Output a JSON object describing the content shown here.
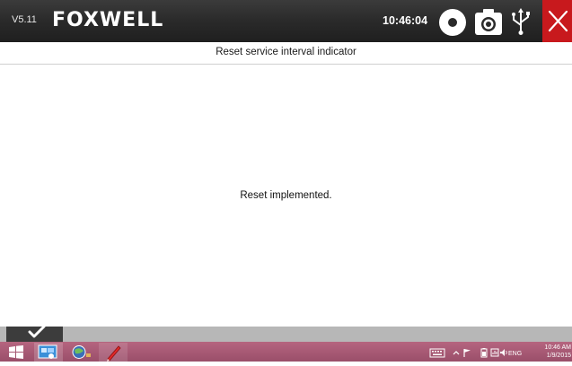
{
  "header": {
    "version": "V5.11",
    "logo_text": "FOXWELL",
    "clock": "10:46:04",
    "icons": [
      "record-icon",
      "camera-icon",
      "usb-icon",
      "close-icon"
    ],
    "close_color": "#c8191d"
  },
  "subtitle": "Reset service interval indicator",
  "main": {
    "message": "Reset implemented."
  },
  "bottom_bar": {
    "ok_icon": "check-icon"
  },
  "taskbar": {
    "start_icon": "windows-start-icon",
    "apps": [
      "desktop-app-icon",
      "globe-app-icon",
      "pen-app-icon"
    ],
    "tray_icons": [
      "keyboard-icon",
      "chevron-up-icon",
      "flag-icon",
      "battery-icon",
      "network-icon",
      "volume-icon"
    ],
    "language": "ENG",
    "time": "10:46 AM",
    "date": "1/9/2015"
  },
  "colors": {
    "header_bg": "#2a2a2a",
    "taskbar_bg": "#a85873",
    "bottom_bar_bg": "#b7b7b7"
  }
}
